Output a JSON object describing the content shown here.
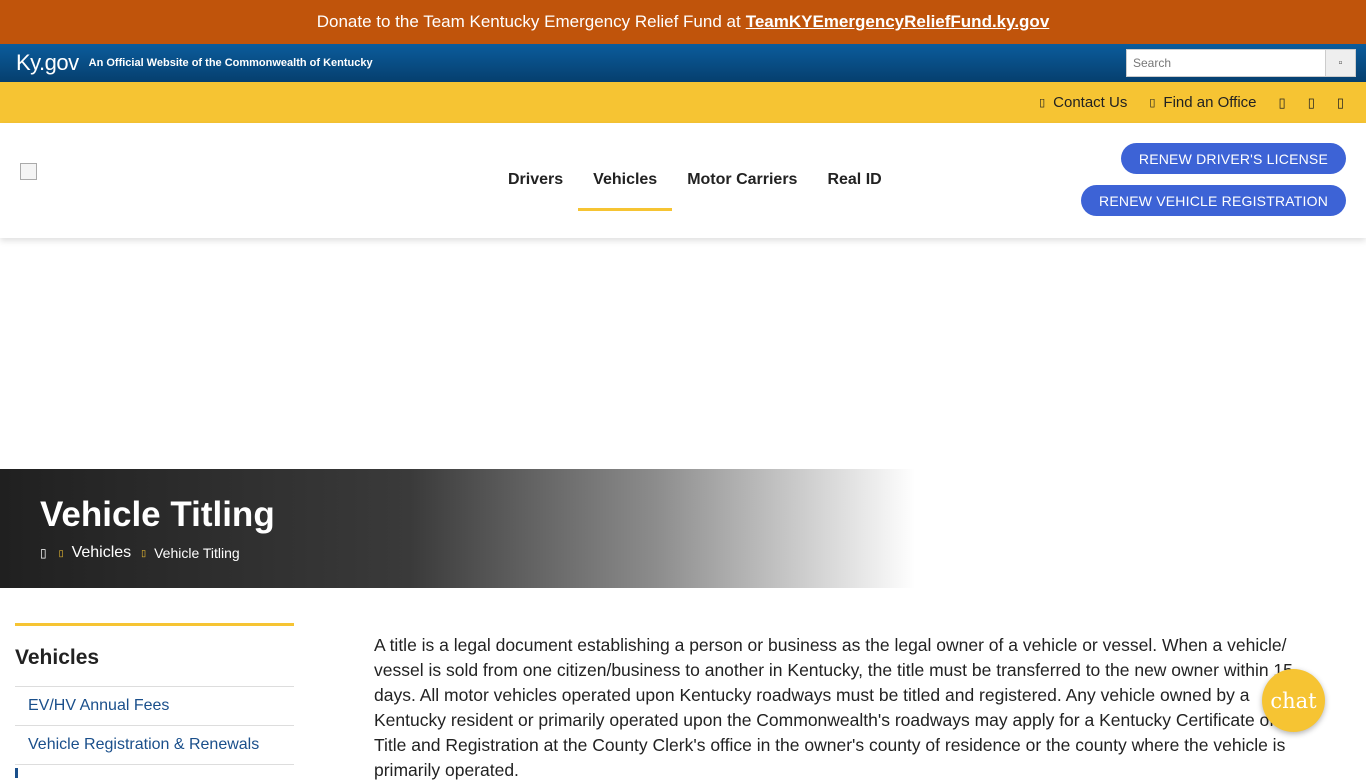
{
  "donate": {
    "text": "Donate to the Team Kentucky Emergency Relief Fund at",
    "link": "TeamKYEmergencyReliefFund.ky.gov"
  },
  "kygov": {
    "logo": "Ky.gov",
    "tagline": "An Official Website of the Commonwealth of Kentucky",
    "search_placeholder": "Search",
    "search_icon": "search-icon"
  },
  "utility": {
    "contact": "Contact Us",
    "office": "Find an Office",
    "icons": [
      "contact-icon",
      "map-marker-icon",
      "social-icon-1",
      "social-icon-2",
      "social-icon-3"
    ]
  },
  "nav": {
    "items": [
      "Drivers",
      "Vehicles",
      "Motor Carriers",
      "Real ID"
    ],
    "active": "Vehicles"
  },
  "cta": {
    "renew_license": "RENEW DRIVER'S LICENSE",
    "renew_registration": "RENEW VEHICLE REGISTRATION"
  },
  "hero": {
    "title": "Vehicle Titling",
    "breadcrumb": [
      "Vehicles",
      "Vehicle Titling"
    ]
  },
  "sidebar": {
    "heading": "Vehicles",
    "items": [
      "EV/HV Annual Fees",
      "Vehicle Registration & Renewals"
    ]
  },
  "content": {
    "paragraph": "A title is a legal document establishing a person or business as the legal owner of a vehicle or vessel. When a vehicle/ vessel is sold from one citizen/business to another in Kentucky, the title must be transferred to the new owner within 15 days. All motor vehicles operated upon Kentucky roadways must be titled and registered. Any vehicle owned by a Kentucky resident or primarily operated upon the Commonwealth's roadways may apply for a Kentucky Certificate of Title and Registration at the County Clerk's office in the owner's county of residence or the county where the vehicle is primarily operated."
  },
  "chat": {
    "label": "chat"
  },
  "colors": {
    "donate_bg": "#c0540b",
    "kygov_bg": "#0b5c9c",
    "accent_yellow": "#f6c433",
    "cta_blue": "#3d63d6",
    "link_blue": "#1a4f8b"
  }
}
